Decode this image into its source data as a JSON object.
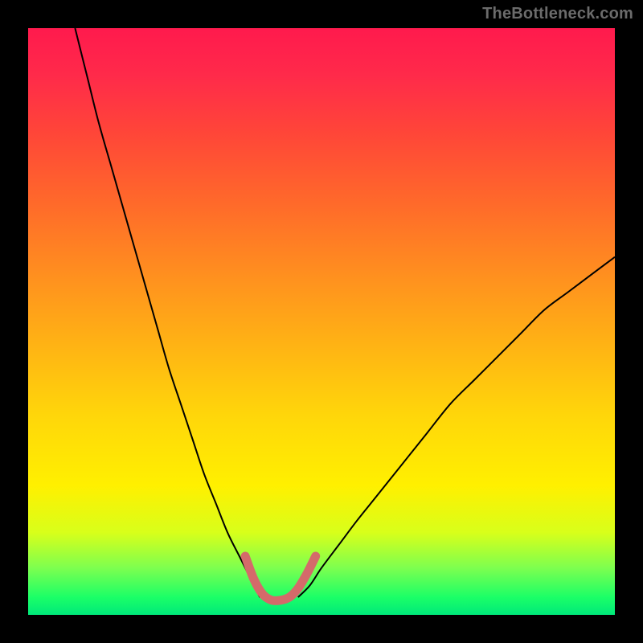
{
  "watermark": "TheBottleneck.com",
  "chart_data": {
    "type": "line",
    "title": "",
    "xlabel": "",
    "ylabel": "",
    "xlim": [
      0,
      100
    ],
    "ylim": [
      0,
      100
    ],
    "grid": false,
    "legend": false,
    "annotations": [],
    "series": [
      {
        "name": "left-branch",
        "x": [
          8,
          10,
          12,
          14,
          16,
          18,
          20,
          22,
          24,
          26,
          28,
          30,
          32,
          34,
          36,
          38,
          39.5
        ],
        "y": [
          100,
          92,
          84,
          77,
          70,
          63,
          56,
          49,
          42,
          36,
          30,
          24,
          19,
          14,
          10,
          6,
          3
        ]
      },
      {
        "name": "right-branch",
        "x": [
          46,
          48,
          50,
          53,
          56,
          60,
          64,
          68,
          72,
          76,
          80,
          84,
          88,
          92,
          96,
          100
        ],
        "y": [
          3,
          5,
          8,
          12,
          16,
          21,
          26,
          31,
          36,
          40,
          44,
          48,
          52,
          55,
          58,
          61
        ]
      },
      {
        "name": "valley-highlight",
        "x": [
          37,
          38.5,
          40,
          41.5,
          43,
          44.5,
          46,
          47.5,
          49
        ],
        "y": [
          10,
          6,
          3.5,
          2.5,
          2.5,
          3,
          4.5,
          7,
          10
        ]
      }
    ],
    "note": "Values are estimated from pixel positions on an unlabeled axis; x and y are on a 0–100 scale matching the plot area."
  }
}
